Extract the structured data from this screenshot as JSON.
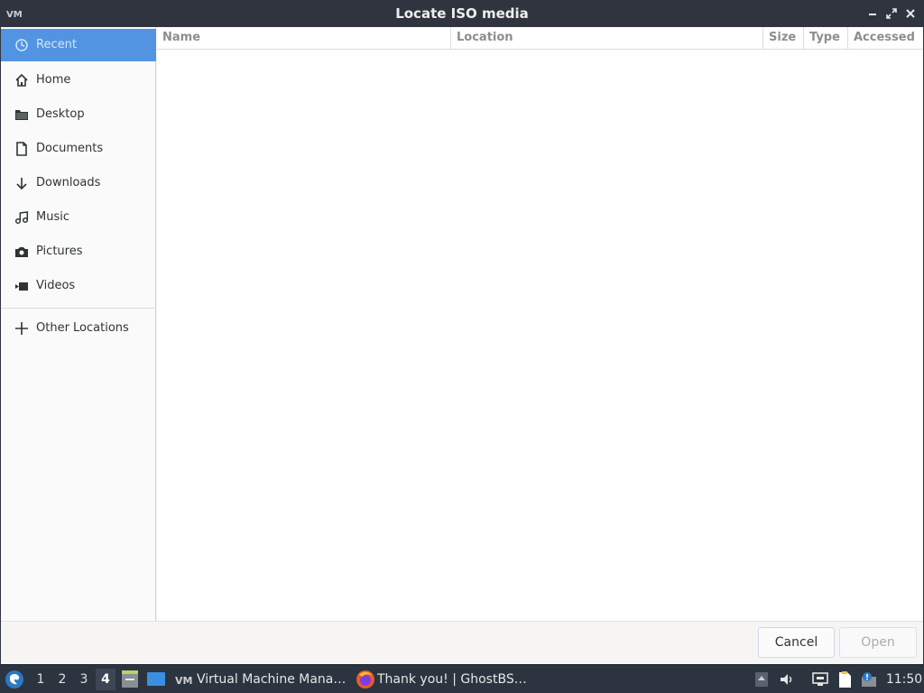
{
  "window": {
    "title": "Locate ISO media",
    "app_icon": "virt-manager-icon",
    "controls": [
      "minimize-icon",
      "maximize-icon",
      "close-icon"
    ]
  },
  "sidebar": {
    "items": [
      {
        "label": "Recent",
        "icon": "recent-clock-icon",
        "active": true
      },
      {
        "label": "Home",
        "icon": "home-icon"
      },
      {
        "label": "Desktop",
        "icon": "folder-icon"
      },
      {
        "label": "Documents",
        "icon": "document-icon"
      },
      {
        "label": "Downloads",
        "icon": "download-arrow-icon"
      },
      {
        "label": "Music",
        "icon": "music-note-icon"
      },
      {
        "label": "Pictures",
        "icon": "camera-icon"
      },
      {
        "label": "Videos",
        "icon": "video-icon"
      }
    ],
    "other_locations": {
      "label": "Other Locations",
      "icon": "plus-icon"
    }
  },
  "filelist": {
    "columns": [
      "Name",
      "Location",
      "Size",
      "Type",
      "Accessed"
    ],
    "rows": []
  },
  "actions": {
    "cancel_label": "Cancel",
    "open_label": "Open"
  },
  "taskbar": {
    "workspaces": [
      "1",
      "2",
      "3",
      "4"
    ],
    "active_workspace": "4",
    "tasks": [
      {
        "label": "Virtual Machine Mana…",
        "icon": "virt-manager-icon"
      },
      {
        "label": "Thank you! | GhostBS…",
        "icon": "firefox-icon"
      }
    ],
    "clock": "11:50"
  },
  "colors": {
    "titlebar": "#2f343f",
    "accent": "#5294e2",
    "taskbar": "#2c3440"
  }
}
